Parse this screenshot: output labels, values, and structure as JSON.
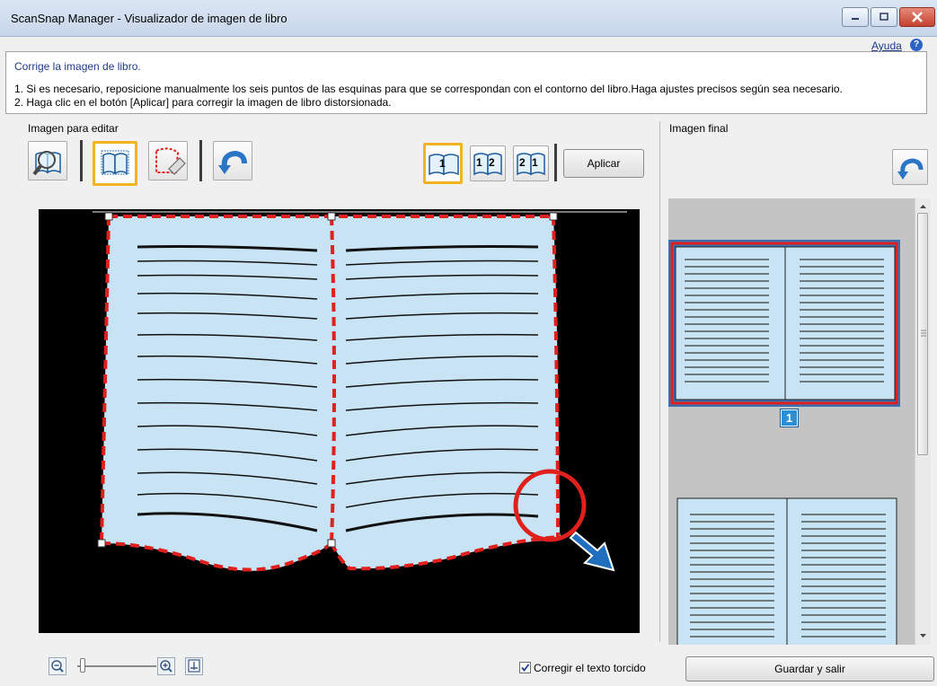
{
  "window": {
    "title": "ScanSnap Manager - Visualizador de imagen de libro"
  },
  "instructions": {
    "heading": "Corrige la imagen de libro.",
    "line1": "1. Si es necesario, reposicione manualmente los seis puntos de las esquinas para que se correspondan con el contorno del libro.Haga ajustes precisos según sea necesario.",
    "line2": "2. Haga clic en el botón [Aplicar] para corregir la imagen de libro distorsionada.",
    "help_label": "Ayuda"
  },
  "left_panel": {
    "label": "Imagen para editar",
    "tools": [
      {
        "icon": "magnify-book-icon"
      },
      {
        "icon": "book-edit-icon",
        "selected": true
      },
      {
        "icon": "eraser-selection-icon"
      },
      {
        "icon": "undo-icon"
      }
    ],
    "page_modes": [
      {
        "label": "1",
        "selected": true
      },
      {
        "label": "1 2"
      },
      {
        "label": "2 1"
      }
    ],
    "apply_label": "Aplicar"
  },
  "right_panel": {
    "label": "Imagen final",
    "page_number": "1"
  },
  "bottom": {
    "checkbox_label": "Corregir el texto torcido",
    "checkbox_checked": true,
    "save_label": "Guardar y salir"
  },
  "colors": {
    "highlight": "#f2b320",
    "page_fill": "#c8e3f3",
    "dash_red": "#e0201c",
    "annotation_blue": "#1f6fbe"
  }
}
